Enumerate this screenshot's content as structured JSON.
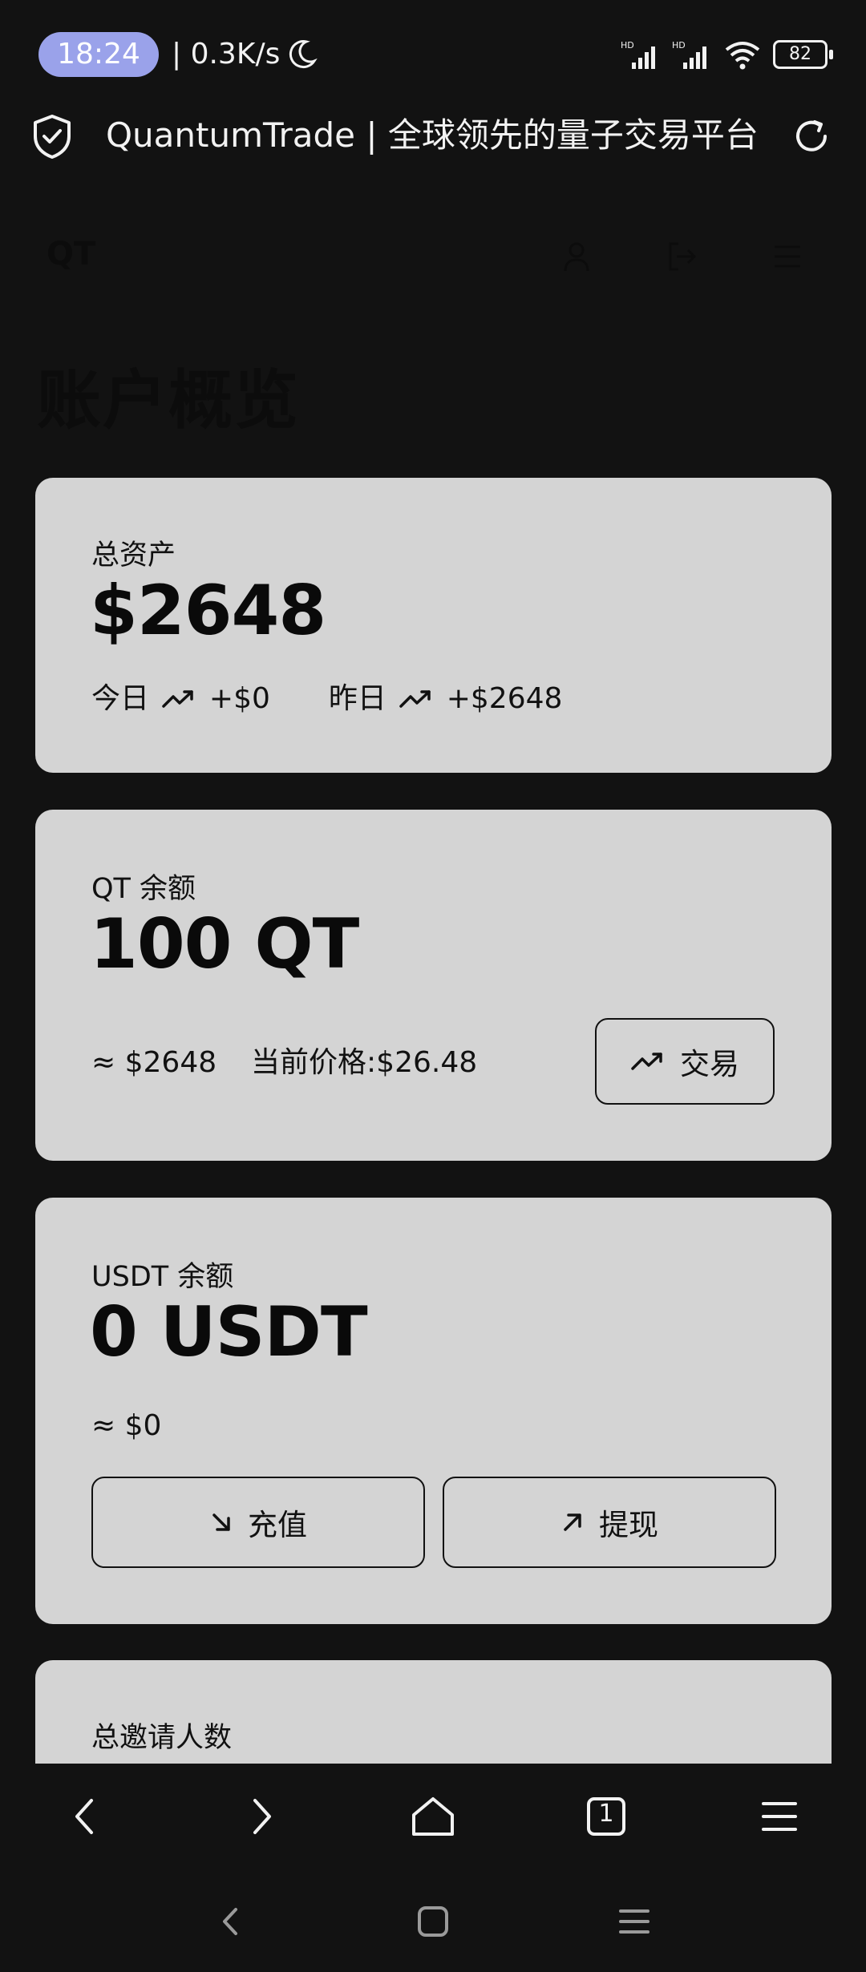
{
  "status_bar": {
    "time": "18:24",
    "net_speed": "0.3K/s",
    "battery": "82",
    "signal_label": "HD"
  },
  "browser": {
    "page_title": "QuantumTrade | 全球领先的量子交易平台"
  },
  "site": {
    "logo": "QT",
    "heading": "账户概览"
  },
  "total_assets": {
    "label": "总资产",
    "value": "$2648",
    "today_label": "今日",
    "today_change": "+$0",
    "yesterday_label": "昨日",
    "yesterday_change": "+$2648"
  },
  "qt_balance": {
    "label": "QT 余额",
    "value": "100 QT",
    "usd_equiv": "≈ $2648",
    "price": "当前价格:$26.48",
    "trade_button": "交易"
  },
  "usdt_balance": {
    "label": "USDT 余额",
    "value": "0 USDT",
    "usd_equiv": "≈ $0",
    "deposit_button": "充值",
    "withdraw_button": "提现"
  },
  "invites": {
    "label": "总邀请人数"
  },
  "browser_nav": {
    "tabs_count": "1"
  },
  "colors": {
    "background": "#121212",
    "card": "#d4d4d4",
    "time_pill": "#9aa2ea"
  }
}
